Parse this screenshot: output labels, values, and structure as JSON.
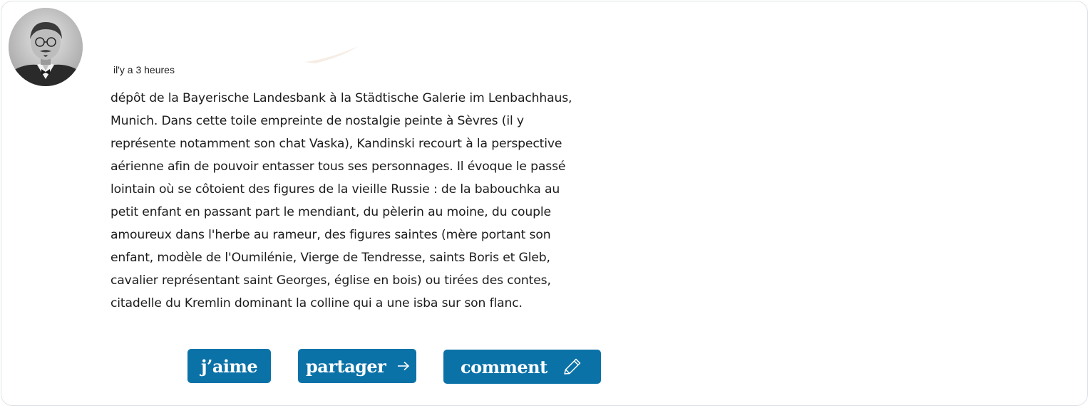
{
  "post": {
    "timestamp": "il'y a 3 heures",
    "body": "dépôt de la Bayerische Landesbank à la Städtische Galerie im Lenbachhaus,\nMunich. Dans cette toile empreinte de nostalgie peinte à Sèvres (il y\nreprésente notamment son chat Vaska), Kandinski recourt à la perspective\naérienne afin de pouvoir entasser tous ses personnages. Il évoque le passé\nlointain où se côtoient des figures de la vieille Russie : de la babouchka au\npetit enfant en passant part le mendiant, du pèlerin au moine, du couple\namoureux dans l'herbe au rameur, des figures saintes (mère portant son\nenfant, modèle de l'Oumilénie, Vierge de Tendresse, saints Boris et Gleb,\ncavalier représentant saint Georges, église en bois) ou tirées des contes,\ncitadelle du Kremlin dominant la colline qui a une isba sur son flanc."
  },
  "actions": {
    "like_label": "j’aime",
    "share_label": "partager",
    "comment_label": "comment"
  },
  "icons": {
    "share": "arrow-right-icon",
    "comment": "pencil-icon"
  },
  "colors": {
    "button_bg": "#0b72a8",
    "button_text": "#ffffff",
    "card_border": "#dfe3e8"
  }
}
